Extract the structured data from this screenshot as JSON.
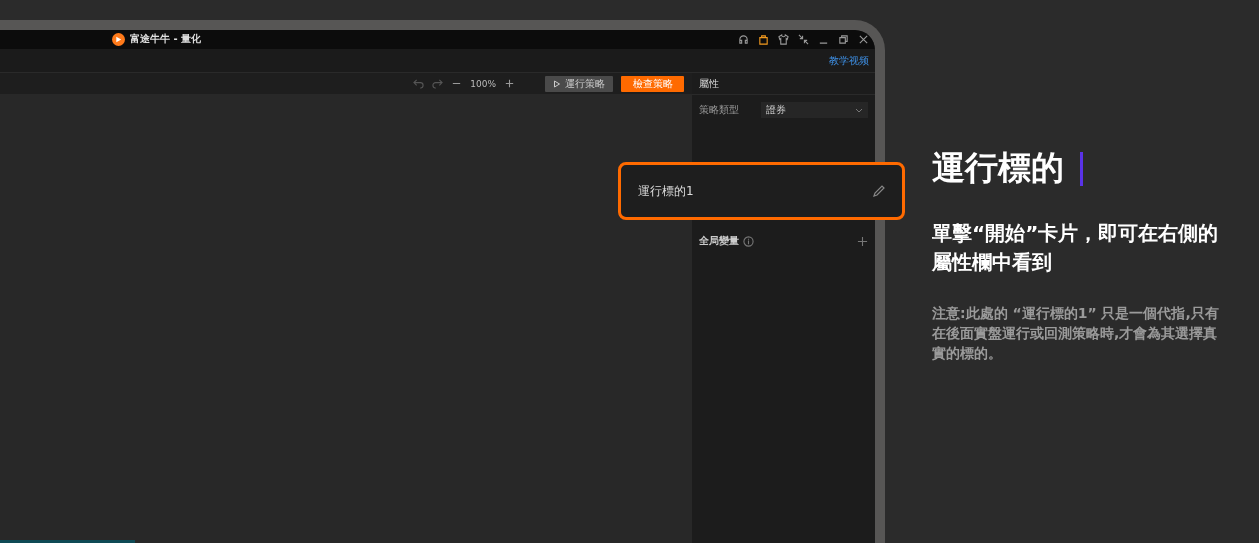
{
  "window": {
    "title": "富途牛牛 - 量化"
  },
  "menu_bar": {
    "link": "教学视频"
  },
  "toolbar": {
    "zoom": "100%",
    "buttons": [
      {
        "label": "運行策略",
        "kind": "secondary"
      },
      {
        "label": "檢查策略",
        "kind": "primary"
      }
    ]
  },
  "properties_panel": {
    "title": "屬性",
    "strategy_type": {
      "label": "策略類型",
      "value": "證券"
    },
    "global_variables": {
      "label": "全局變量"
    }
  },
  "callout": {
    "value": "運行標的1"
  },
  "guide": {
    "title": "運行標的",
    "subtitle": "單擊“開始”卡片，即可在右側的屬性欄中看到",
    "note": "注意:此處的 “運行標的1” 只是一個代指,只有在後面實盤運行或回測策略時,才會為其選擇真實的標的。"
  }
}
